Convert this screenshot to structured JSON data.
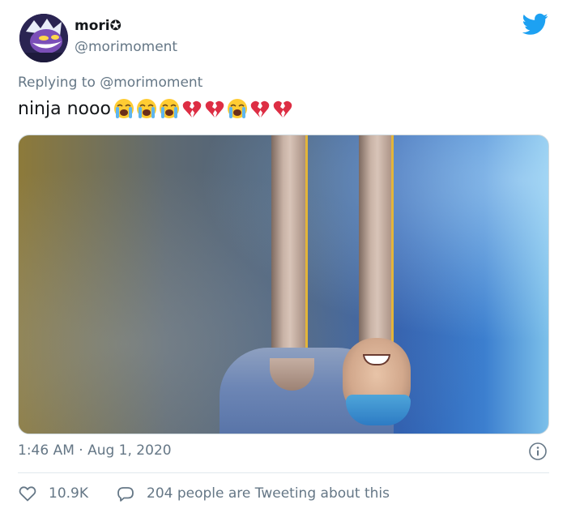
{
  "tweet": {
    "author": {
      "display_name": "mori✪",
      "handle": "@morimoment"
    },
    "reply_prefix": "Replying to ",
    "reply_to": "@morimoment",
    "text": "ninja nooo",
    "emojis": [
      "loudly-crying-face",
      "loudly-crying-face",
      "loudly-crying-face",
      "broken-heart",
      "broken-heart",
      "loudly-crying-face",
      "broken-heart",
      "broken-heart"
    ],
    "timestamp": "1:46 AM · Aug 1, 2020",
    "likes": "10.9K",
    "replies_text": "204 people are Tweeting about this"
  },
  "colors": {
    "brand": "#1da1f2",
    "secondary_text": "#657786",
    "primary_text": "#14171a"
  },
  "icons": {
    "logo": "twitter-bird-icon",
    "info": "info-icon",
    "like": "heart-icon",
    "reply": "speech-bubble-icon"
  }
}
